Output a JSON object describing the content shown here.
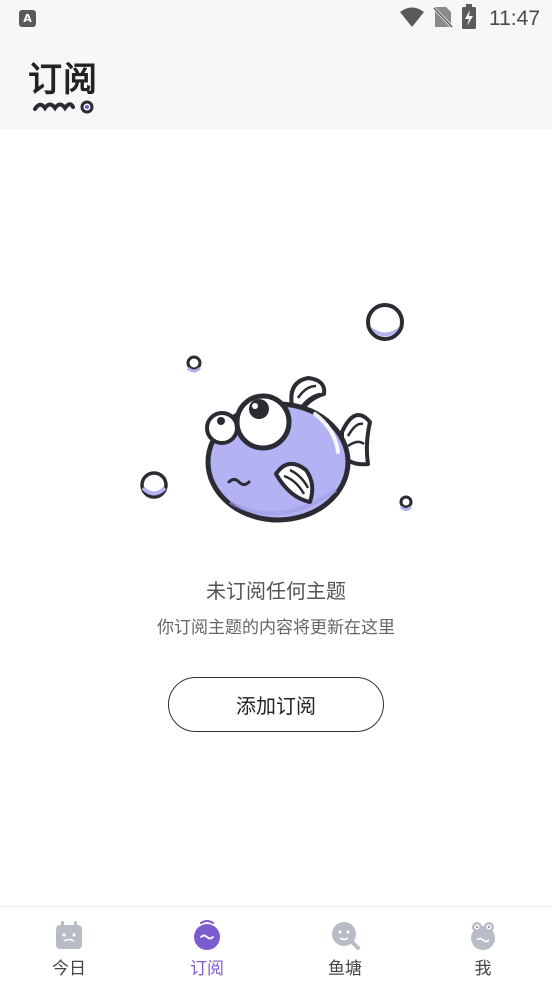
{
  "status_bar": {
    "app_icon_letter": "A",
    "time": "11:47",
    "icons": [
      "wifi-icon",
      "no-sim-icon",
      "battery-charging-icon"
    ]
  },
  "header": {
    "title": "订阅"
  },
  "empty_state": {
    "title": "未订阅任何主题",
    "subtitle": "你订阅主题的内容将更新在这里",
    "button_label": "添加订阅"
  },
  "bottom_nav": {
    "items": [
      {
        "label": "今日",
        "icon": "calendar-face-icon",
        "active": false
      },
      {
        "label": "订阅",
        "icon": "subscribe-face-icon",
        "active": true
      },
      {
        "label": "鱼塘",
        "icon": "fishpond-search-icon",
        "active": false
      },
      {
        "label": "我",
        "icon": "profile-frog-icon",
        "active": false
      }
    ]
  },
  "colors": {
    "accent": "#7b5ccf",
    "fish_body": "#b3b2f3",
    "header_bg": "#f7f7f7",
    "outline": "#2b2b33"
  }
}
